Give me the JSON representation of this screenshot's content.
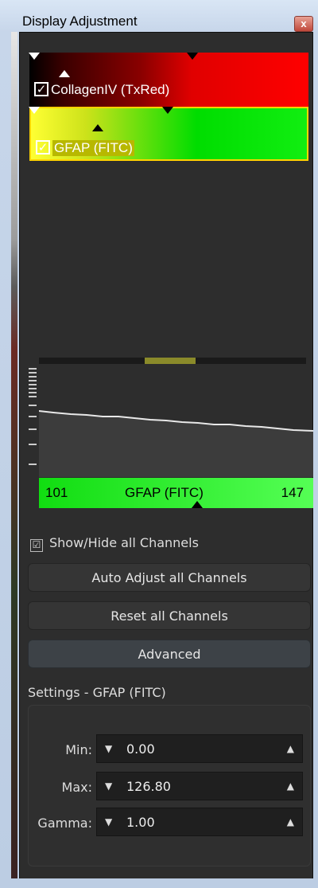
{
  "window": {
    "title": "Display Adjustment",
    "close_label": "x"
  },
  "channels": [
    {
      "name": "CollagenIV (TxRed)",
      "checked": "✓",
      "color": "#ff0000"
    },
    {
      "name": "GFAP (FITC)",
      "checked": "✓",
      "color": "#00dd00"
    }
  ],
  "histogram": {
    "min": "101",
    "channel": "GFAP (FITC)",
    "max": "147"
  },
  "show_hide": {
    "label": "Show/Hide all Channels",
    "checked": "☑"
  },
  "buttons": {
    "auto_adjust": "Auto Adjust all Channels",
    "reset": "Reset all Channels",
    "advanced": "Advanced"
  },
  "settings": {
    "title": "Settings - GFAP (FITC)",
    "fields": [
      {
        "label": "Min:",
        "value": "0.00"
      },
      {
        "label": "Max:",
        "value": "126.80"
      },
      {
        "label": "Gamma:",
        "value": "1.00"
      }
    ]
  }
}
